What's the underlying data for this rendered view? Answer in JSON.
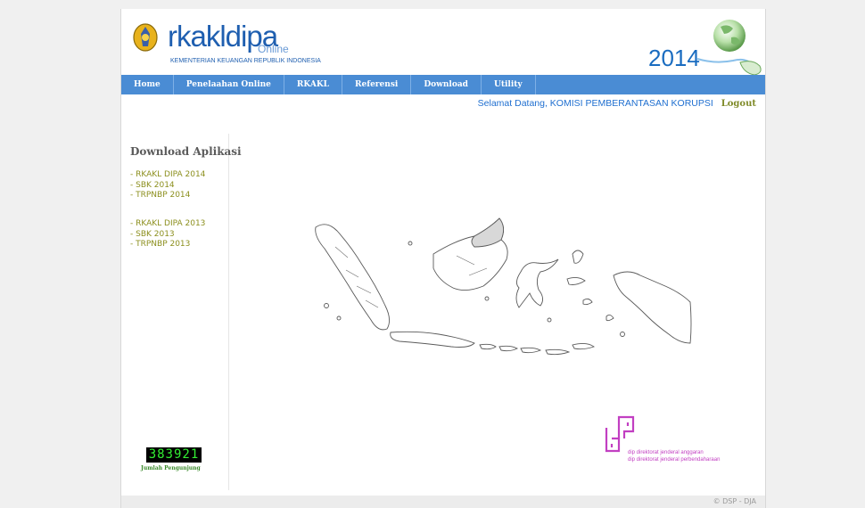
{
  "header": {
    "brand": "rkakldipa",
    "brand_suffix": "Online",
    "ministry": "KEMENTERIAN KEUANGAN REPUBLIK INDONESIA",
    "year": "2014"
  },
  "nav": [
    "Home",
    "Penelaahan Online",
    "RKAKL",
    "Referensi",
    "Download",
    "Utility"
  ],
  "welcome": {
    "text": "Selamat Datang, KOMISI PEMBERANTASAN KORUPSI",
    "logout": "Logout"
  },
  "sidebar": {
    "title": "Download Aplikasi",
    "group_2014": [
      "- RKAKL DIPA 2014",
      "- SBK 2014",
      "- TRPNBP 2014"
    ],
    "group_2013": [
      "- RKAKL DIPA 2013",
      "- SBK 2013",
      "- TRPNBP 2013"
    ]
  },
  "counter": {
    "value": "383921",
    "label": "Jumlah Pengunjung"
  },
  "djpb": {
    "line1": "dip direktorat jenderal anggaran",
    "line2": "dip direktorat jenderal perbendaharaan"
  },
  "footer": "© DSP - DJA",
  "colors": {
    "nav_bg": "#4a8cd4",
    "brand": "#1f5fb0",
    "link_olive": "#8c8f1e",
    "welcome_blue": "#1f6fd0",
    "logo_purple": "#c23fc2"
  }
}
